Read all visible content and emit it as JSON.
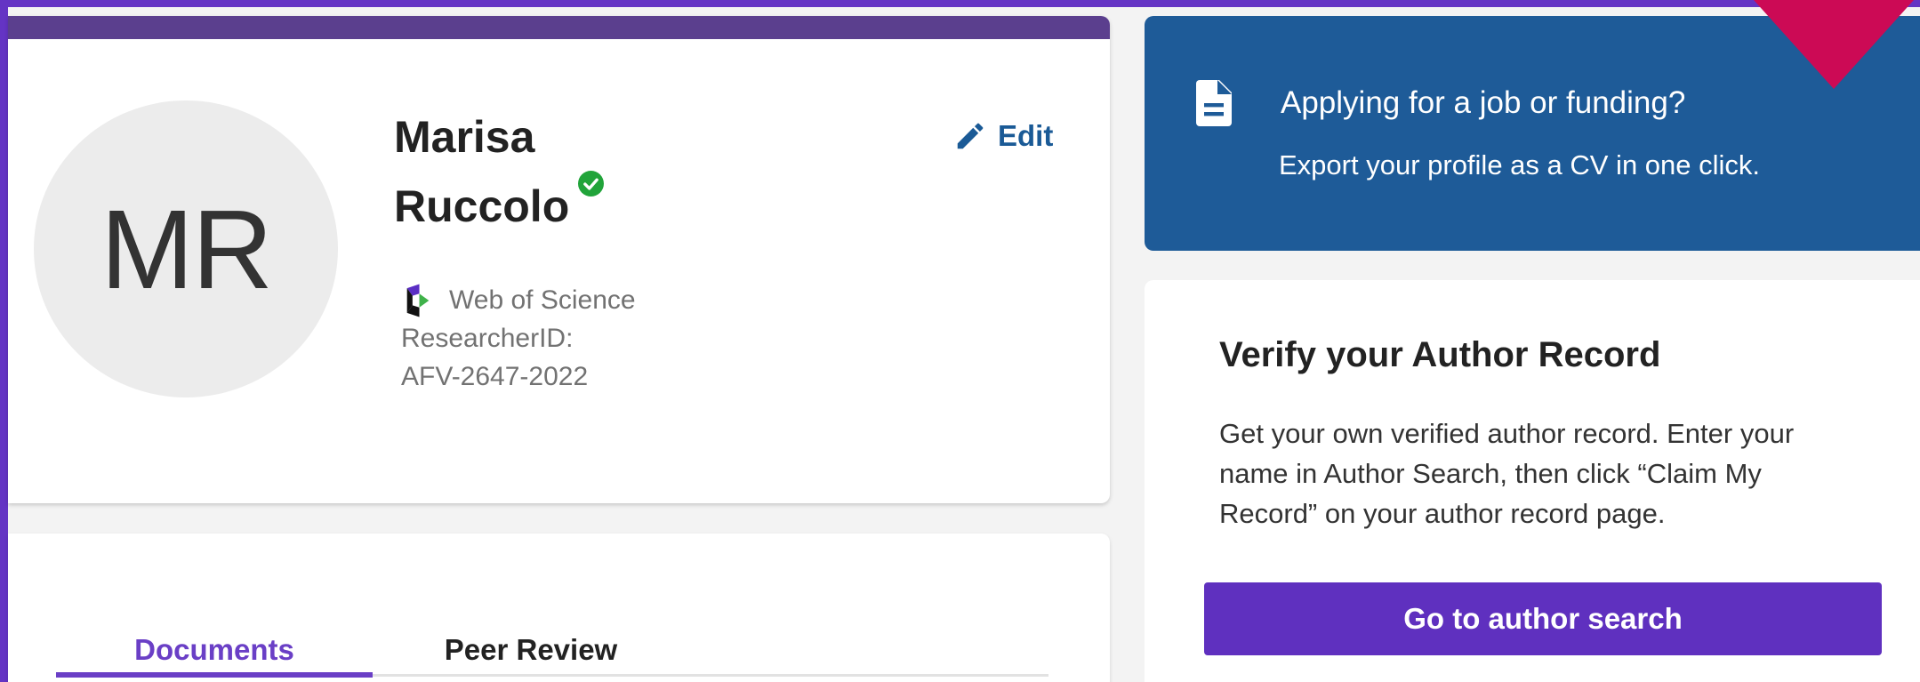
{
  "profile": {
    "avatar_initials": "MR",
    "name_first": "Marisa",
    "name_last": "Ruccolo",
    "edit_label": "Edit",
    "source_label": "Web of Science",
    "researcher_id_label": "ResearcherID:",
    "researcher_id_value": "AFV-2647-2022"
  },
  "tabs": [
    {
      "label": "Documents",
      "active": true
    },
    {
      "label": "Peer Review",
      "active": false
    }
  ],
  "cv_banner": {
    "title": "Applying for a job or funding?",
    "subtitle": "Export your profile as a CV in one click."
  },
  "verify": {
    "title": "Verify your Author Record",
    "text": "Get your own verified author record. Enter your name in Author Search, then click “Claim My Record” on your author record page.",
    "button_label": "Go to author search"
  },
  "colors": {
    "frame": "#6434c4",
    "accent_purple": "#6a3fc6",
    "banner_blue": "#1e5b98",
    "edit_blue": "#1a5a96",
    "verified_green": "#21a43a",
    "arrow_magenta": "#cc0a55"
  },
  "icons": {
    "edit": "pencil-icon",
    "verified": "check-circle-icon",
    "source": "web-of-science-logo",
    "cv": "document-icon",
    "pointer": "arrow-down-icon"
  }
}
